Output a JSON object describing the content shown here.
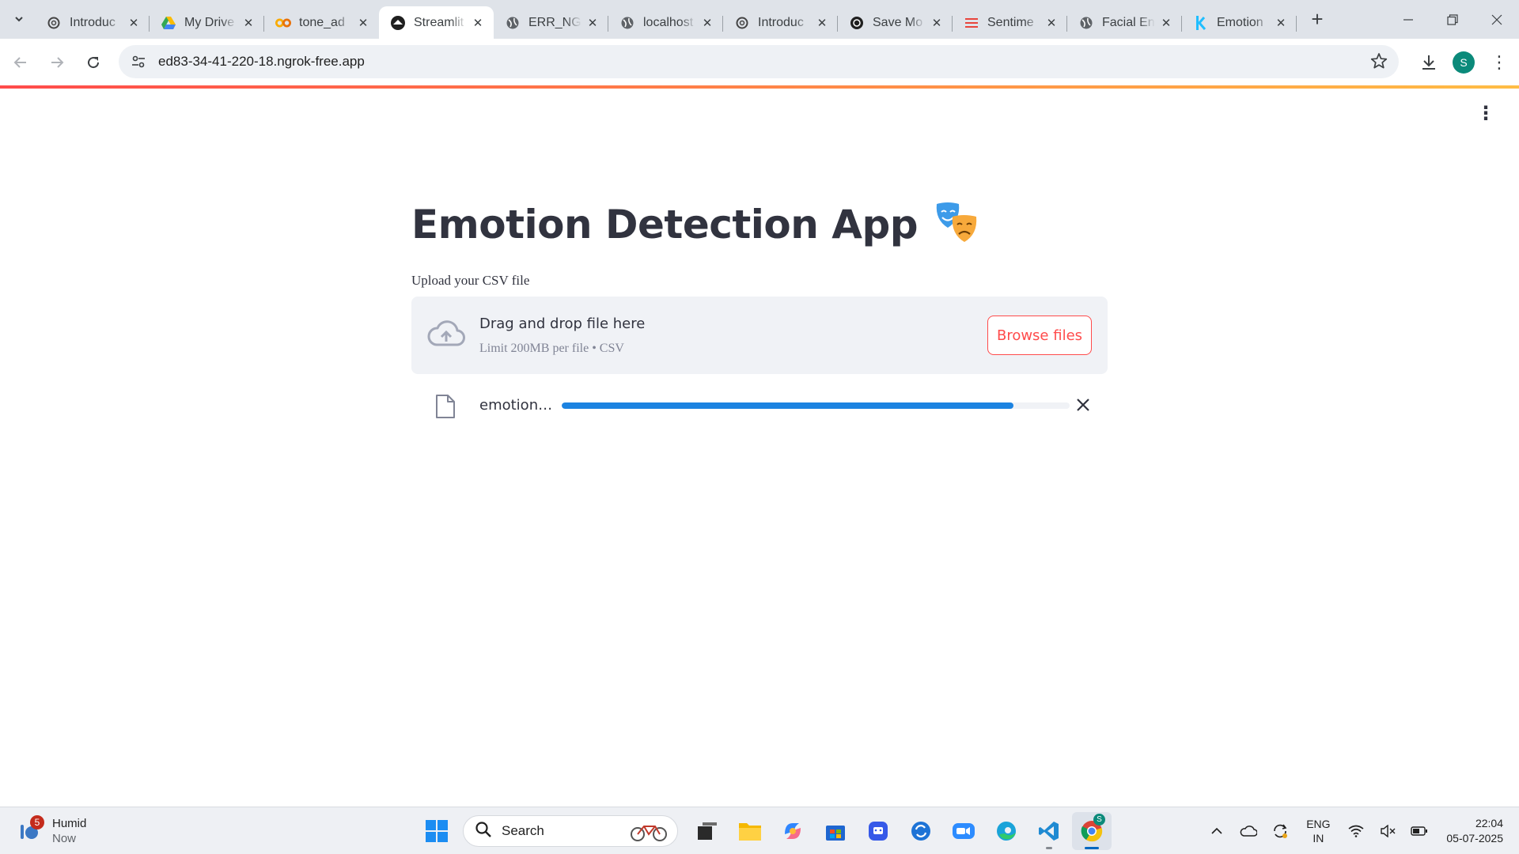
{
  "browser": {
    "tabs": [
      {
        "label": "Introduc",
        "icon": "openai-icon"
      },
      {
        "label": "My Drive",
        "icon": "google-drive-icon"
      },
      {
        "label": "tone_ad",
        "icon": "colab-icon"
      },
      {
        "label": "Streamlit",
        "icon": "streamlit-icon",
        "active": true
      },
      {
        "label": "ERR_NGI",
        "icon": "globe-icon"
      },
      {
        "label": "localhost",
        "icon": "globe-icon"
      },
      {
        "label": "Introduc",
        "icon": "openai-icon"
      },
      {
        "label": "Save Mo",
        "icon": "openai-icon"
      },
      {
        "label": "Sentime",
        "icon": "menu-lines-icon"
      },
      {
        "label": "Facial En",
        "icon": "globe-icon"
      },
      {
        "label": "Emotion",
        "icon": "kaggle-icon"
      }
    ],
    "url": "ed83-34-41-220-18.ngrok-free.app",
    "profile_initial": "S"
  },
  "app": {
    "title": "Emotion Detection App",
    "title_icon": "performing-arts-masks-icon",
    "uploader": {
      "label": "Upload your CSV file",
      "drop_text": "Drag and drop file here",
      "limit_text": "Limit 200MB per file • CSV",
      "browse_label": "Browse files"
    },
    "file": {
      "name": "emotion…",
      "progress": 0.89
    }
  },
  "taskbar": {
    "weather": {
      "badge": "5",
      "title": "Humid",
      "subtitle": "Now"
    },
    "search_placeholder": "Search",
    "lang_primary": "ENG",
    "lang_secondary": "IN",
    "time": "22:04",
    "date": "05-07-2025",
    "chrome_badge": "S"
  },
  "colors": {
    "streamlit_red": "#ff4b4b",
    "progress_blue": "#1c83e1",
    "dropzone_bg": "#f0f2f6",
    "text_dark": "#31333f"
  }
}
